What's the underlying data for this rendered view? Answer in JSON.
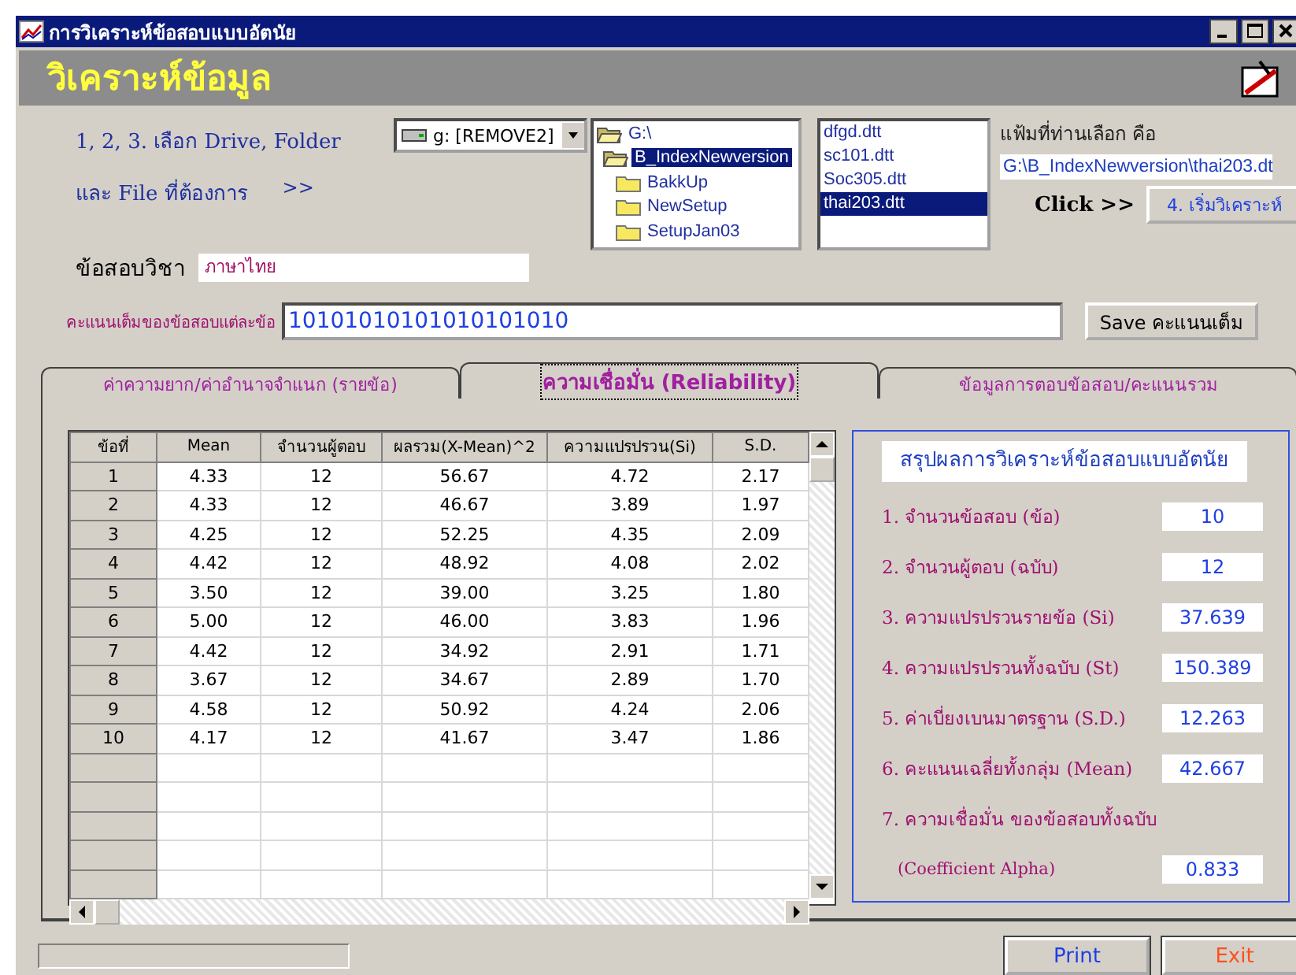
{
  "window": {
    "title": "การวิเคราะห์ข้อสอบแบบอัตนัย"
  },
  "header": {
    "title": "วิเคราะห์ข้อมูล"
  },
  "steps": {
    "line1": "1, 2, 3. เลือก Drive, Folder",
    "line2": "และ File ที่ต้องการ",
    "arrow": ">>"
  },
  "drive": {
    "value": "g: [REMOVE2]"
  },
  "folders": [
    {
      "name": "G:\\",
      "open": true,
      "selected": false,
      "children": [
        {
          "name": "B_IndexNewversion",
          "open": true,
          "selected": true,
          "children": [
            {
              "name": "BakkUp",
              "open": false,
              "selected": false
            },
            {
              "name": "NewSetup",
              "open": false,
              "selected": false
            },
            {
              "name": "SetupJan03",
              "open": false,
              "selected": false
            }
          ]
        }
      ]
    }
  ],
  "files": [
    {
      "name": "dfgd.dtt",
      "selected": false
    },
    {
      "name": "sc101.dtt",
      "selected": false
    },
    {
      "name": "Soc305.dtt",
      "selected": false
    },
    {
      "name": "thai203.dtt",
      "selected": true
    }
  ],
  "chosen": {
    "label": "แฟ้มที่ท่านเลือก คือ",
    "path": "G:\\B_IndexNewversion\\thai203.dt"
  },
  "click_label": "Click >>",
  "analyze_button": "4. เริ่มวิเคราะห์",
  "subject": {
    "label": "ข้อสอบวิชา",
    "value": "ภาษาไทย"
  },
  "full_score": {
    "label": "คะแนนเต็มของข้อสอบแต่ละข้อ",
    "value": "10101010101010101010"
  },
  "save_button": "Save คะแนนเต็ม",
  "tabs": [
    {
      "label": "ค่าความยาก/ค่าอำนาจจำแนก (รายข้อ)",
      "selected": false
    },
    {
      "label": "ความเชื่อมั่น (Reliability)",
      "selected": true
    },
    {
      "label": "ข้อมูลการตอบข้อสอบ/คะแนนรวม",
      "selected": false
    }
  ],
  "table": {
    "columns": [
      "ข้อที่",
      "Mean",
      "จำนวนผู้ตอบ",
      "ผลรวม(X-Mean)^2",
      "ความแปรปรวน(Si)",
      "S.D."
    ],
    "rows": [
      [
        "1",
        "4.33",
        "12",
        "56.67",
        "4.72",
        "2.17"
      ],
      [
        "2",
        "4.33",
        "12",
        "46.67",
        "3.89",
        "1.97"
      ],
      [
        "3",
        "4.25",
        "12",
        "52.25",
        "4.35",
        "2.09"
      ],
      [
        "4",
        "4.42",
        "12",
        "48.92",
        "4.08",
        "2.02"
      ],
      [
        "5",
        "3.50",
        "12",
        "39.00",
        "3.25",
        "1.80"
      ],
      [
        "6",
        "5.00",
        "12",
        "46.00",
        "3.83",
        "1.96"
      ],
      [
        "7",
        "4.42",
        "12",
        "34.92",
        "2.91",
        "1.71"
      ],
      [
        "8",
        "3.67",
        "12",
        "34.67",
        "2.89",
        "1.70"
      ],
      [
        "9",
        "4.58",
        "12",
        "50.92",
        "4.24",
        "2.06"
      ],
      [
        "10",
        "4.17",
        "12",
        "41.67",
        "3.47",
        "1.86"
      ]
    ]
  },
  "summary": {
    "title": "สรุปผลการวิเคราะห์ข้อสอบแบบอัตนัย",
    "items": [
      {
        "label": "1. จำนวนข้อสอบ (ข้อ)",
        "value": "10"
      },
      {
        "label": "2. จำนวนผู้ตอบ (ฉบับ)",
        "value": "12"
      },
      {
        "label": "3. ความแปรปรวนรายข้อ (Si)",
        "value": "37.639"
      },
      {
        "label": "4. ความแปรปรวนทั้งฉบับ (St)",
        "value": "150.389"
      },
      {
        "label": "5. ค่าเบี่ยงเบนมาตรฐาน (S.D.)",
        "value": "12.263"
      },
      {
        "label": "6. คะแนนเฉลี่ยทั้งกลุ่ม (Mean)",
        "value": "42.667"
      },
      {
        "label": "7. ความเชื่อมั่น ของข้อสอบทั้งฉบับ"
      },
      {
        "label": "(Coefficient Alpha)",
        "value": "0.833"
      }
    ]
  },
  "buttons": [
    {
      "label": "Print",
      "kind": "print"
    },
    {
      "label": "Exit",
      "kind": "exit"
    }
  ]
}
